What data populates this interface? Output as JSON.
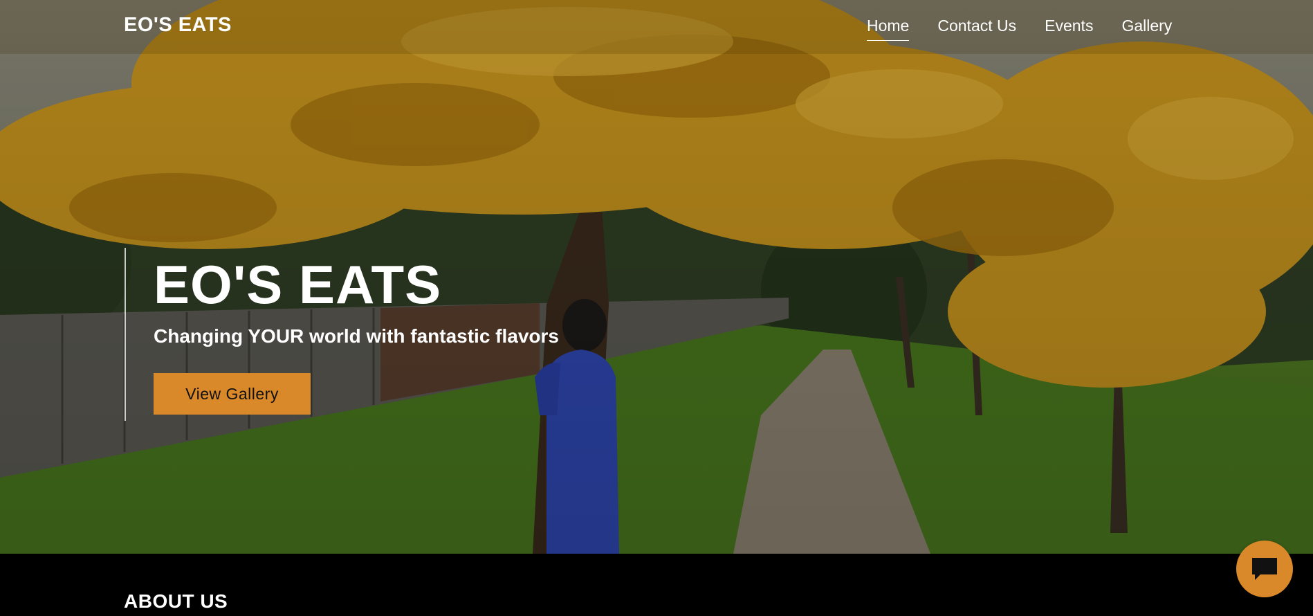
{
  "header": {
    "brand": "EO'S EATS",
    "nav": [
      {
        "label": "Home",
        "active": true
      },
      {
        "label": "Contact Us",
        "active": false
      },
      {
        "label": "Events",
        "active": false
      },
      {
        "label": "Gallery",
        "active": false
      }
    ]
  },
  "hero": {
    "title": "EO'S EATS",
    "tagline": "Changing YOUR world with fantastic flavors",
    "cta_label": "View Gallery",
    "background_icon": "autumn-park-photo"
  },
  "about": {
    "title": "ABOUT US"
  },
  "chat": {
    "icon": "chat-bubble-icon"
  },
  "colors": {
    "accent": "#d9892a",
    "text": "#ffffff",
    "section_bg": "#000000"
  }
}
